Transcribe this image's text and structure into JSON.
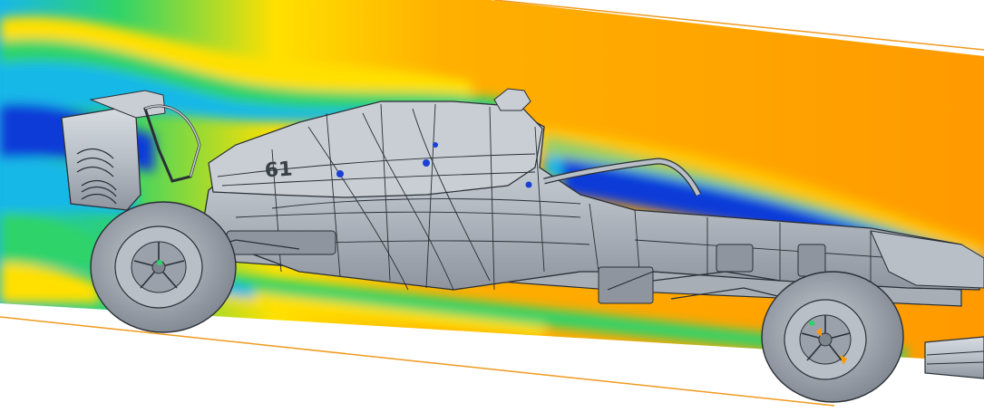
{
  "car": {
    "number": "61"
  },
  "colors": {
    "background": "#ffffff",
    "flow_high": "#ff9a00",
    "flow_mid": "#ffe000",
    "flow_green": "#2fd36a",
    "flow_cyan": "#18b8e8",
    "flow_low": "#0a3ad8",
    "body": "#b9bfc7",
    "body_dark": "#7d858f",
    "edges": "#2a2f36",
    "guide_line": "#f09a1e"
  },
  "icons": {
    "rear_wing": "rear-wing-icon",
    "front_wing": "front-wing-icon",
    "wheel": "wheel-icon"
  }
}
